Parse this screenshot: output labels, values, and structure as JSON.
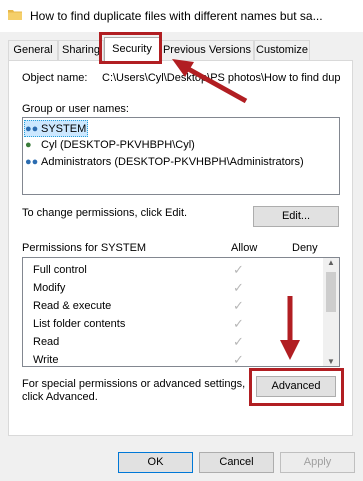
{
  "window": {
    "title": "How to find duplicate files with different names but sa..."
  },
  "tabs": [
    {
      "label": "General"
    },
    {
      "label": "Sharing"
    },
    {
      "label": "Security"
    },
    {
      "label": "Previous Versions"
    },
    {
      "label": "Customize"
    }
  ],
  "object": {
    "label": "Object name:",
    "value": "C:\\Users\\Cyl\\Desktop\\PS photos\\How to find dup"
  },
  "groups": {
    "label": "Group or user names:",
    "items": [
      {
        "name": "SYSTEM"
      },
      {
        "name": "Cyl (DESKTOP-PKVHBPH\\Cyl)"
      },
      {
        "name": "Administrators (DESKTOP-PKVHBPH\\Administrators)"
      }
    ]
  },
  "change": {
    "text": "To change permissions, click Edit.",
    "button": "Edit..."
  },
  "permissions": {
    "header": "Permissions for SYSTEM",
    "allow": "Allow",
    "deny": "Deny",
    "rows": [
      {
        "name": "Full control",
        "allow": "✓"
      },
      {
        "name": "Modify",
        "allow": "✓"
      },
      {
        "name": "Read & execute",
        "allow": "✓"
      },
      {
        "name": "List folder contents",
        "allow": "✓"
      },
      {
        "name": "Read",
        "allow": "✓"
      },
      {
        "name": "Write",
        "allow": "✓"
      }
    ]
  },
  "advanced": {
    "text1": "For special permissions or advanced settings,",
    "text2": "click Advanced.",
    "button": "Advanced"
  },
  "footer": {
    "ok": "OK",
    "cancel": "Cancel",
    "apply": "Apply"
  },
  "colors": {
    "annotation_red": "#b11e22",
    "selection": "#cce8ff"
  }
}
